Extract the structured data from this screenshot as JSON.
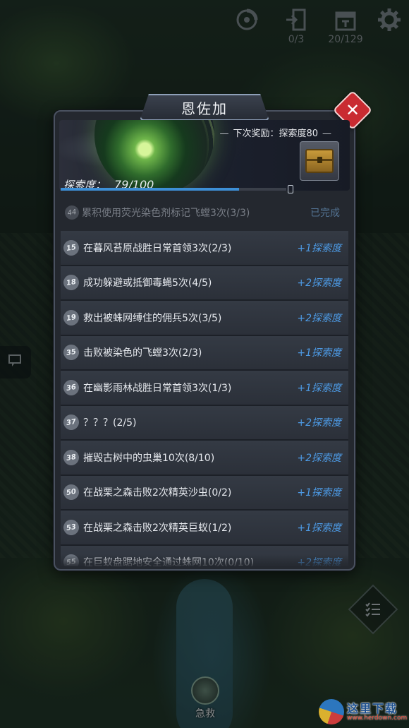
{
  "hud": {
    "skill_icon": "swirl-icon",
    "exit_value": "0/3",
    "calendar_value": "20/129",
    "settings_icon": "gear-icon"
  },
  "dialog": {
    "title": "恩佐加",
    "next_reward_label": "下次奖励：探索度80",
    "exploration_label": "探索度：",
    "exploration_value": "79/100",
    "exploration_progress": 0.79
  },
  "completed_task": {
    "number": "44",
    "text": "累积使用荧光染色剂标记飞螳3次(3/3)",
    "status": "已完成"
  },
  "tasks": [
    {
      "number": "15",
      "text": "在暮风苔原战胜日常首领3次(2/3)",
      "reward": "+1探索度"
    },
    {
      "number": "18",
      "text": "成功躲避或抵御毒蝇5次(4/5)",
      "reward": "+2探索度"
    },
    {
      "number": "19",
      "text": "救出被蛛网缚住的佣兵5次(3/5)",
      "reward": "+2探索度"
    },
    {
      "number": "35",
      "text": "击败被染色的飞螳3次(2/3)",
      "reward": "+1探索度"
    },
    {
      "number": "36",
      "text": "在幽影雨林战胜日常首领3次(1/3)",
      "reward": "+1探索度"
    },
    {
      "number": "37",
      "text": "？？？(2/5)",
      "reward": "+2探索度"
    },
    {
      "number": "38",
      "text": "摧毁古树中的虫巢10次(8/10)",
      "reward": "+2探索度"
    },
    {
      "number": "50",
      "text": "在战栗之森击败2次精英沙虫(0/2)",
      "reward": "+1探索度"
    },
    {
      "number": "53",
      "text": "在战栗之森击败2次精英巨蚁(1/2)",
      "reward": "+1探索度"
    },
    {
      "number": "55",
      "text": "在巨蚁盘踞地安全通过蛛网10次(0/10)",
      "reward": "+2探索度"
    }
  ],
  "rescue_label": "急救",
  "watermark": {
    "name": "这里下载",
    "url": "www.herdown.com"
  }
}
